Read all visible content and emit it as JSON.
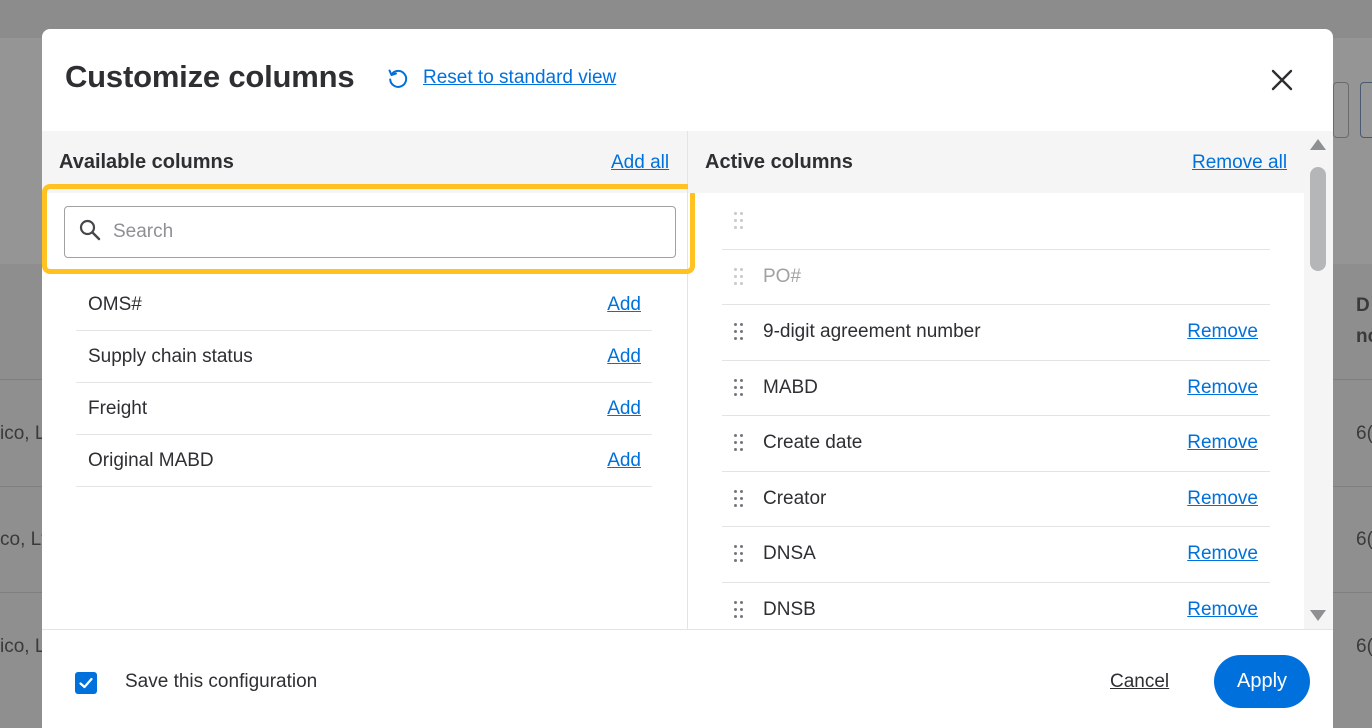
{
  "background": {
    "column_header_partial": "D",
    "column_header_partial_2": "nc",
    "row_fragments": [
      "ico, L",
      "co, Lt",
      "ico, L"
    ],
    "row_values": [
      "6(",
      "6(",
      "6("
    ]
  },
  "modal": {
    "title": "Customize columns",
    "reset_label": "Reset to standard view",
    "close_icon": "close-icon"
  },
  "available": {
    "title": "Available columns",
    "add_all_label": "Add all",
    "search_placeholder": "Search",
    "search_value": "",
    "add_label": "Add",
    "items": [
      {
        "label": "OMS#"
      },
      {
        "label": "Supply chain status"
      },
      {
        "label": "Freight"
      },
      {
        "label": "Original MABD"
      }
    ]
  },
  "active": {
    "title": "Active columns",
    "remove_all_label": "Remove all",
    "remove_label": "Remove",
    "items": [
      {
        "label": "",
        "locked": true
      },
      {
        "label": "PO#",
        "locked": true
      },
      {
        "label": "9-digit agreement number",
        "locked": false
      },
      {
        "label": "MABD",
        "locked": false
      },
      {
        "label": "Create date",
        "locked": false
      },
      {
        "label": "Creator",
        "locked": false
      },
      {
        "label": "DNSA",
        "locked": false
      },
      {
        "label": "DNSB",
        "locked": false
      }
    ]
  },
  "footer": {
    "save_config_label": "Save this configuration",
    "save_config_checked": true,
    "cancel_label": "Cancel",
    "apply_label": "Apply"
  },
  "colors": {
    "accent": "#0071dc",
    "highlight": "#ffc220",
    "text": "#2e2f32"
  }
}
